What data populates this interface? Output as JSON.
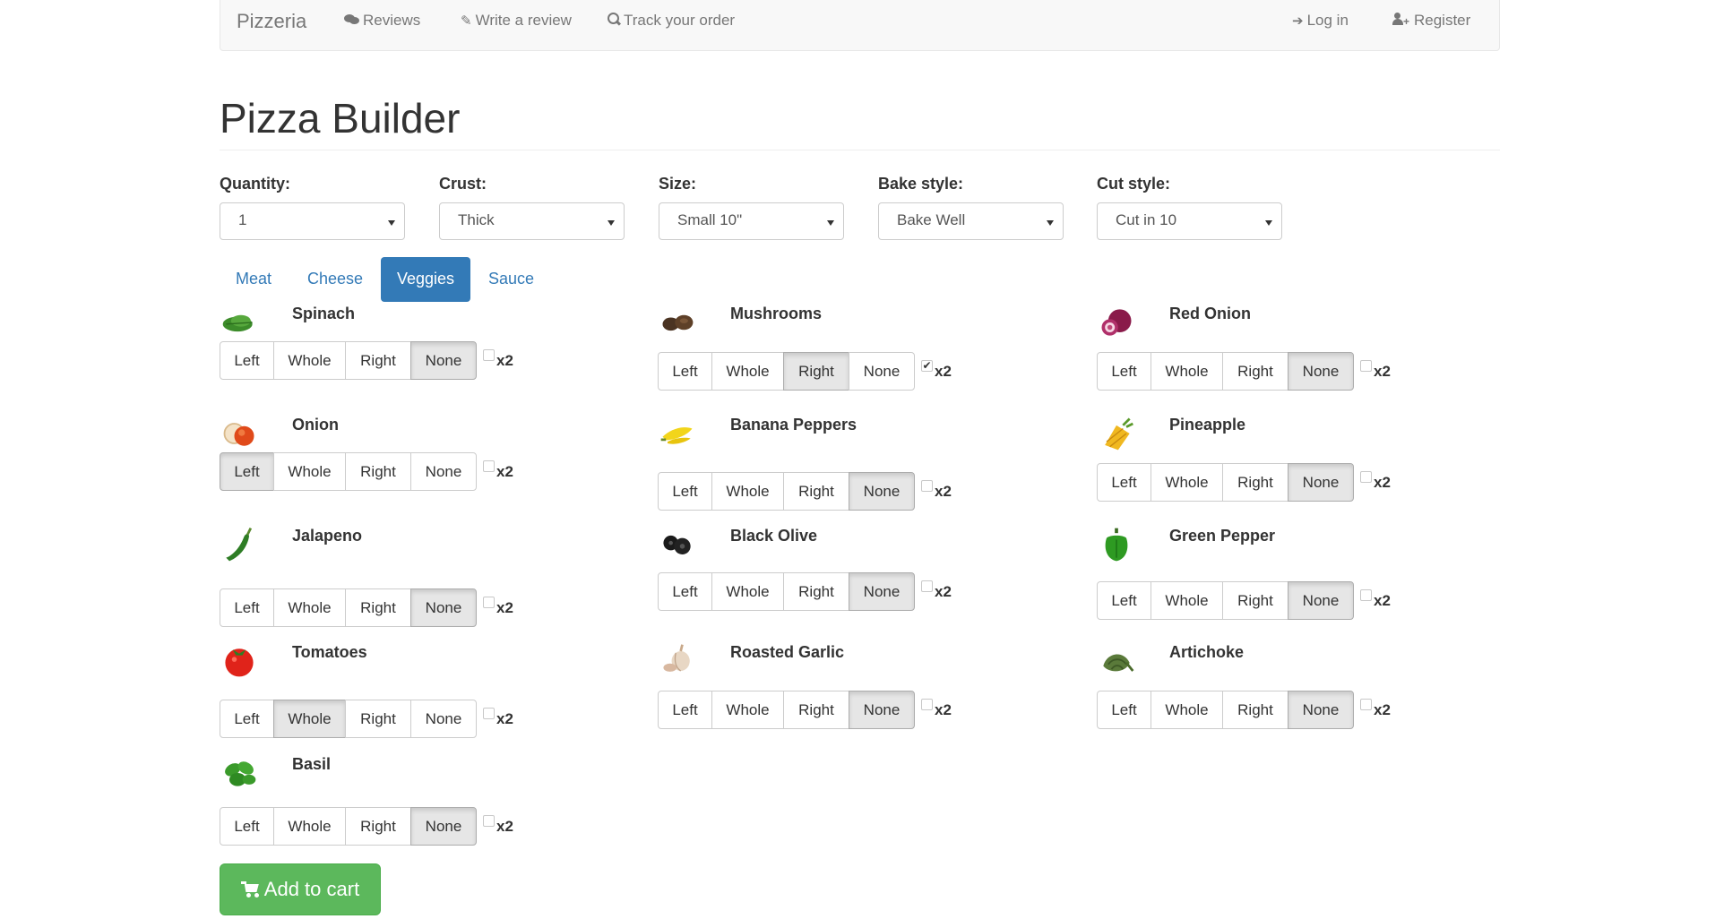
{
  "nav": {
    "brand": "Pizzeria",
    "reviews": "Reviews",
    "write_review": "Write a review",
    "track_order": "Track your order",
    "login": "Log in",
    "register": "Register"
  },
  "page_title": "Pizza Builder",
  "options": {
    "quantity": {
      "label": "Quantity:",
      "value": "1"
    },
    "crust": {
      "label": "Crust:",
      "value": "Thick"
    },
    "size": {
      "label": "Size:",
      "value": "Small 10\""
    },
    "bake": {
      "label": "Bake style:",
      "value": "Bake Well"
    },
    "cut": {
      "label": "Cut style:",
      "value": "Cut in 10"
    }
  },
  "tabs": [
    "Meat",
    "Cheese",
    "Veggies",
    "Sauce"
  ],
  "active_tab": "Veggies",
  "placement_labels": {
    "left": "Left",
    "whole": "Whole",
    "right": "Right",
    "none": "None"
  },
  "double_label": "x2",
  "toppings": [
    {
      "name": "Spinach",
      "selected": "None",
      "double": false
    },
    {
      "name": "Onion",
      "selected": "Left",
      "double": false
    },
    {
      "name": "Jalapeno",
      "selected": "None",
      "double": false
    },
    {
      "name": "Tomatoes",
      "selected": "Whole",
      "double": false
    },
    {
      "name": "Basil",
      "selected": "None",
      "double": false
    },
    {
      "name": "Mushrooms",
      "selected": "Right",
      "double": true
    },
    {
      "name": "Banana Peppers",
      "selected": "None",
      "double": false
    },
    {
      "name": "Black Olive",
      "selected": "None",
      "double": false
    },
    {
      "name": "Roasted Garlic",
      "selected": "None",
      "double": false
    },
    {
      "name": "Red Onion",
      "selected": "None",
      "double": false
    },
    {
      "name": "Pineapple",
      "selected": "None",
      "double": false
    },
    {
      "name": "Green Pepper",
      "selected": "None",
      "double": false
    },
    {
      "name": "Artichoke",
      "selected": "None",
      "double": false
    }
  ],
  "add_to_cart": "Add to cart",
  "colors": {
    "primary": "#337ab7",
    "success": "#5cb85c",
    "navbar_bg": "#f8f8f8"
  }
}
